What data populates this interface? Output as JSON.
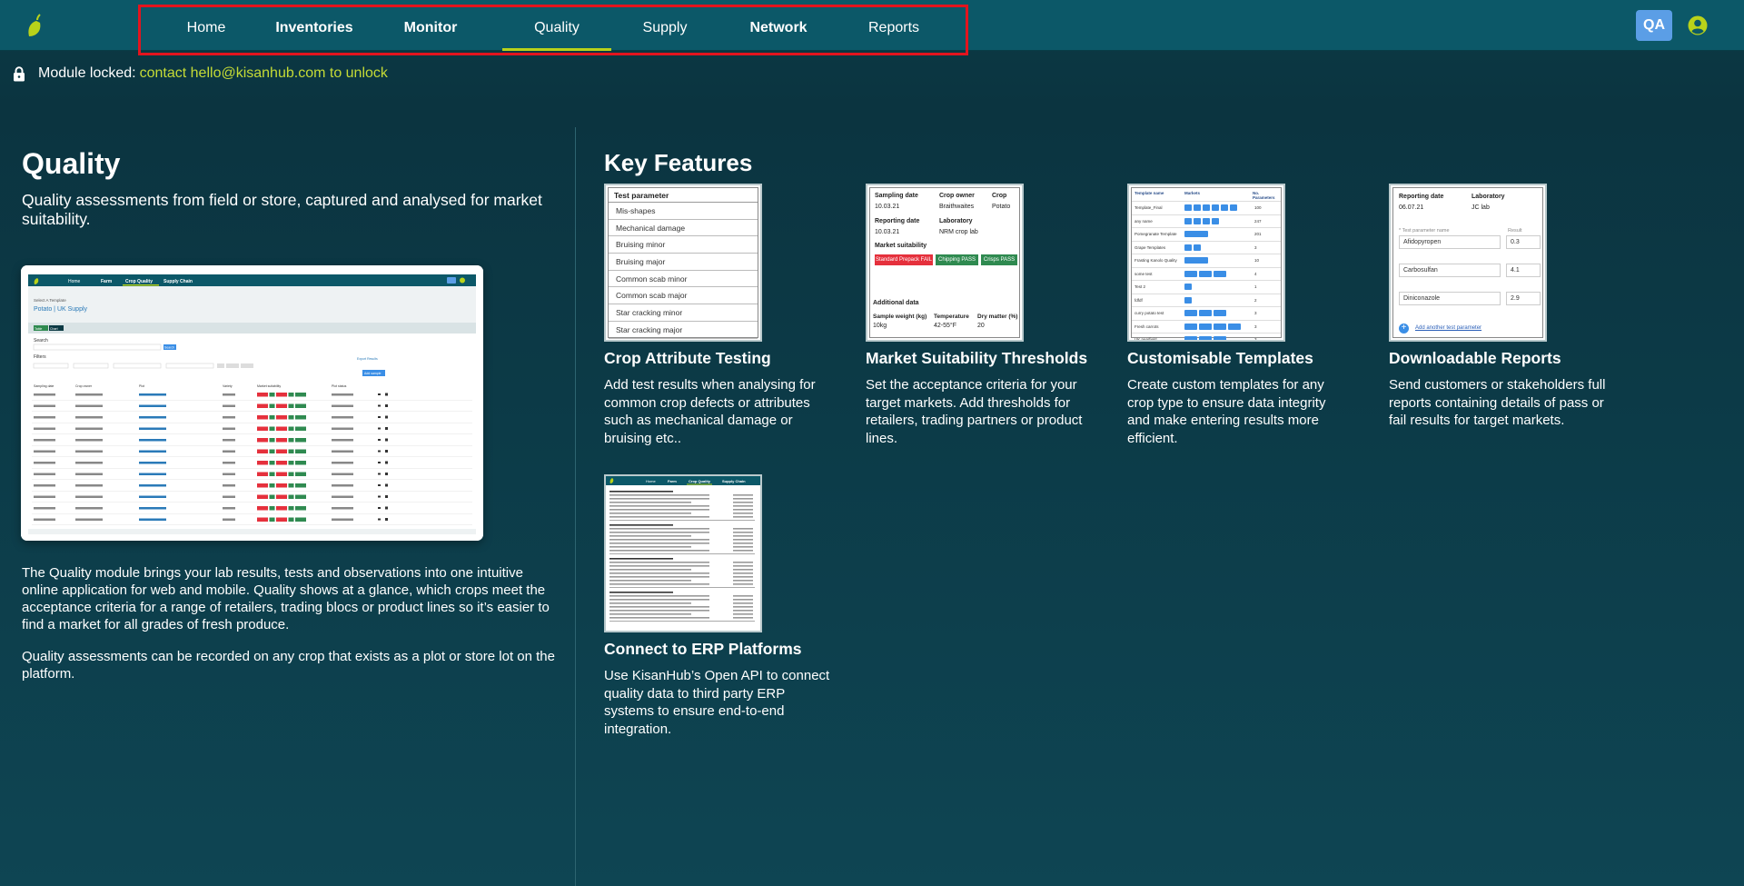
{
  "nav": {
    "items": [
      {
        "label": "Home",
        "bold": false
      },
      {
        "label": "Inventories",
        "bold": true
      },
      {
        "label": "Monitor",
        "bold": true
      },
      {
        "label": "Quality",
        "bold": false,
        "active": true
      },
      {
        "label": "Supply",
        "bold": false
      },
      {
        "label": "Network",
        "bold": true
      },
      {
        "label": "Reports",
        "bold": false
      }
    ],
    "user_badge": "QA"
  },
  "lock": {
    "message": "Module locked:",
    "link": "contact hello@kisanhub.com to unlock"
  },
  "quality": {
    "title": "Quality",
    "subtitle": "Quality assessments from field or store, captured and analysed for market suitability.",
    "para1": "The Quality module brings your lab results, tests and observations into one intuitive online application for web and mobile. Quality shows at a glance, which crops meet the acceptance criteria for a range of retailers, trading blocs or product lines so it’s easier to find a market for all grades of fresh produce.",
    "para2": "Quality assessments can be recorded on any crop that exists as a plot or store lot on the platform."
  },
  "screenshot": {
    "nav": [
      "Home",
      "Farm",
      "Crop Quality",
      "Supply Chain"
    ],
    "template_label": "Select A Template",
    "template_value": "Potato | UK Supply",
    "tabs": [
      "Table",
      "Chart"
    ],
    "search_label": "Search",
    "search_button": "Search",
    "filters_label": "Filters",
    "columns": [
      "Sampling date",
      "Crop owner",
      "Plot",
      "Variety",
      "Market suitability",
      "Plot status"
    ],
    "export_label": "Export Results",
    "add_button": "Add sample"
  },
  "features": {
    "title": "Key Features",
    "items": [
      {
        "title": "Crop Attribute Testing",
        "desc": "Add test results when analysing for common crop defects or attributes such as mechanical damage or bruising etc.."
      },
      {
        "title": "Market Suitability Thresholds",
        "desc": "Set the acceptance criteria for your target markets. Add thresholds for retailers, trading partners or product lines."
      },
      {
        "title": "Customisable Templates",
        "desc": "Create custom templates for any crop type to ensure data integrity and make entering results more efficient."
      },
      {
        "title": "Downloadable Reports",
        "desc": "Send customers or stakeholders full reports containing details of pass or fail results for target markets."
      },
      {
        "title": "Connect to ERP Platforms",
        "desc": "Use KisanHub’s Open API to connect quality data to third party ERP systems to ensure end-to-end integration."
      }
    ]
  },
  "card1": {
    "header": "Test parameter",
    "rows": [
      "Mis-shapes",
      "Mechanical damage",
      "Bruising minor",
      "Bruising major",
      "Common scab minor",
      "Common scab major",
      "Star cracking minor",
      "Star cracking major"
    ]
  },
  "card2": {
    "sampling_date_label": "Sampling date",
    "sampling_date": "10.03.21",
    "crop_owner_label": "Crop owner",
    "crop_owner": "Braithwaites",
    "crop_label": "Crop",
    "crop": "Potato",
    "reporting_date_label": "Reporting date",
    "reporting_date": "10.03.21",
    "laboratory_label": "Laboratory",
    "laboratory": "NRM crop lab",
    "market_label": "Market suitability",
    "badges": [
      "Standard Prepack FAIL",
      "Chipping PASS",
      "Crisps PASS"
    ],
    "additional": "Additional data",
    "weight_label": "Sample weight (kg)",
    "weight": "10kg",
    "temp_label": "Temperature",
    "temp": "42-55°F",
    "dry_label": "Dry matter (%)",
    "dry": "20"
  },
  "card3": {
    "headers": [
      "Template name",
      "Markets",
      "No. Parameters"
    ],
    "rows": [
      {
        "name": "Template_Final",
        "count": "100"
      },
      {
        "name": "any name",
        "count": "247"
      },
      {
        "name": "Pomegranate Template",
        "count": "201"
      },
      {
        "name": "Grape Templates",
        "count": "3"
      },
      {
        "name": "Frasting Kanolo Quality",
        "count": "10"
      },
      {
        "name": "some test",
        "count": "4"
      },
      {
        "name": "Test 2",
        "count": "1"
      },
      {
        "name": "fdfdf",
        "count": "2"
      },
      {
        "name": "curry potato test",
        "count": "3"
      },
      {
        "name": "Fresh carrots",
        "count": "3"
      },
      {
        "name": "UK pea/field",
        "count": "3"
      }
    ]
  },
  "card4": {
    "reporting_label": "Reporting date",
    "reporting": "06.07.21",
    "lab_label": "Laboratory",
    "lab": "JC lab",
    "param_label": "* Test parameter name",
    "result_label": "Result",
    "params": [
      {
        "name": "Afidopyropen",
        "value": "0.3"
      },
      {
        "name": "Carbosulfan",
        "value": "4.1"
      },
      {
        "name": "Diniconazole",
        "value": "2.9"
      }
    ],
    "add_link": "Add another test parameter"
  },
  "card5": {
    "nav": [
      "Home",
      "Farm",
      "Crop Quality",
      "Supply Chain"
    ]
  },
  "colors": {
    "accent": "#b9d21a",
    "link": "#c5db36",
    "topbar": "#0c5868",
    "badge_fail": "#e5303c",
    "badge_pass": "#2f8a50"
  }
}
